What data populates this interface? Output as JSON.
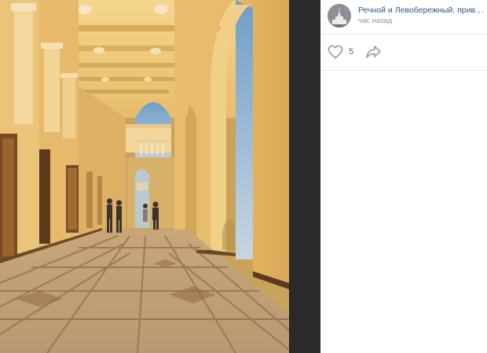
{
  "post": {
    "author_name": "Речной и Левобережный, привива...",
    "time": "час назад",
    "likes_count": "5",
    "avatar_icon": "cathedral-avatar-icon",
    "like_icon": "heart-outline-icon",
    "share_icon": "share-arrow-icon"
  },
  "photo": {
    "subject": "sunlit arched colonnade gallery"
  },
  "colors": {
    "link": "#2a5885",
    "muted": "#939393",
    "icon": "#99a2ad",
    "gutter": "#2a2a2b"
  }
}
